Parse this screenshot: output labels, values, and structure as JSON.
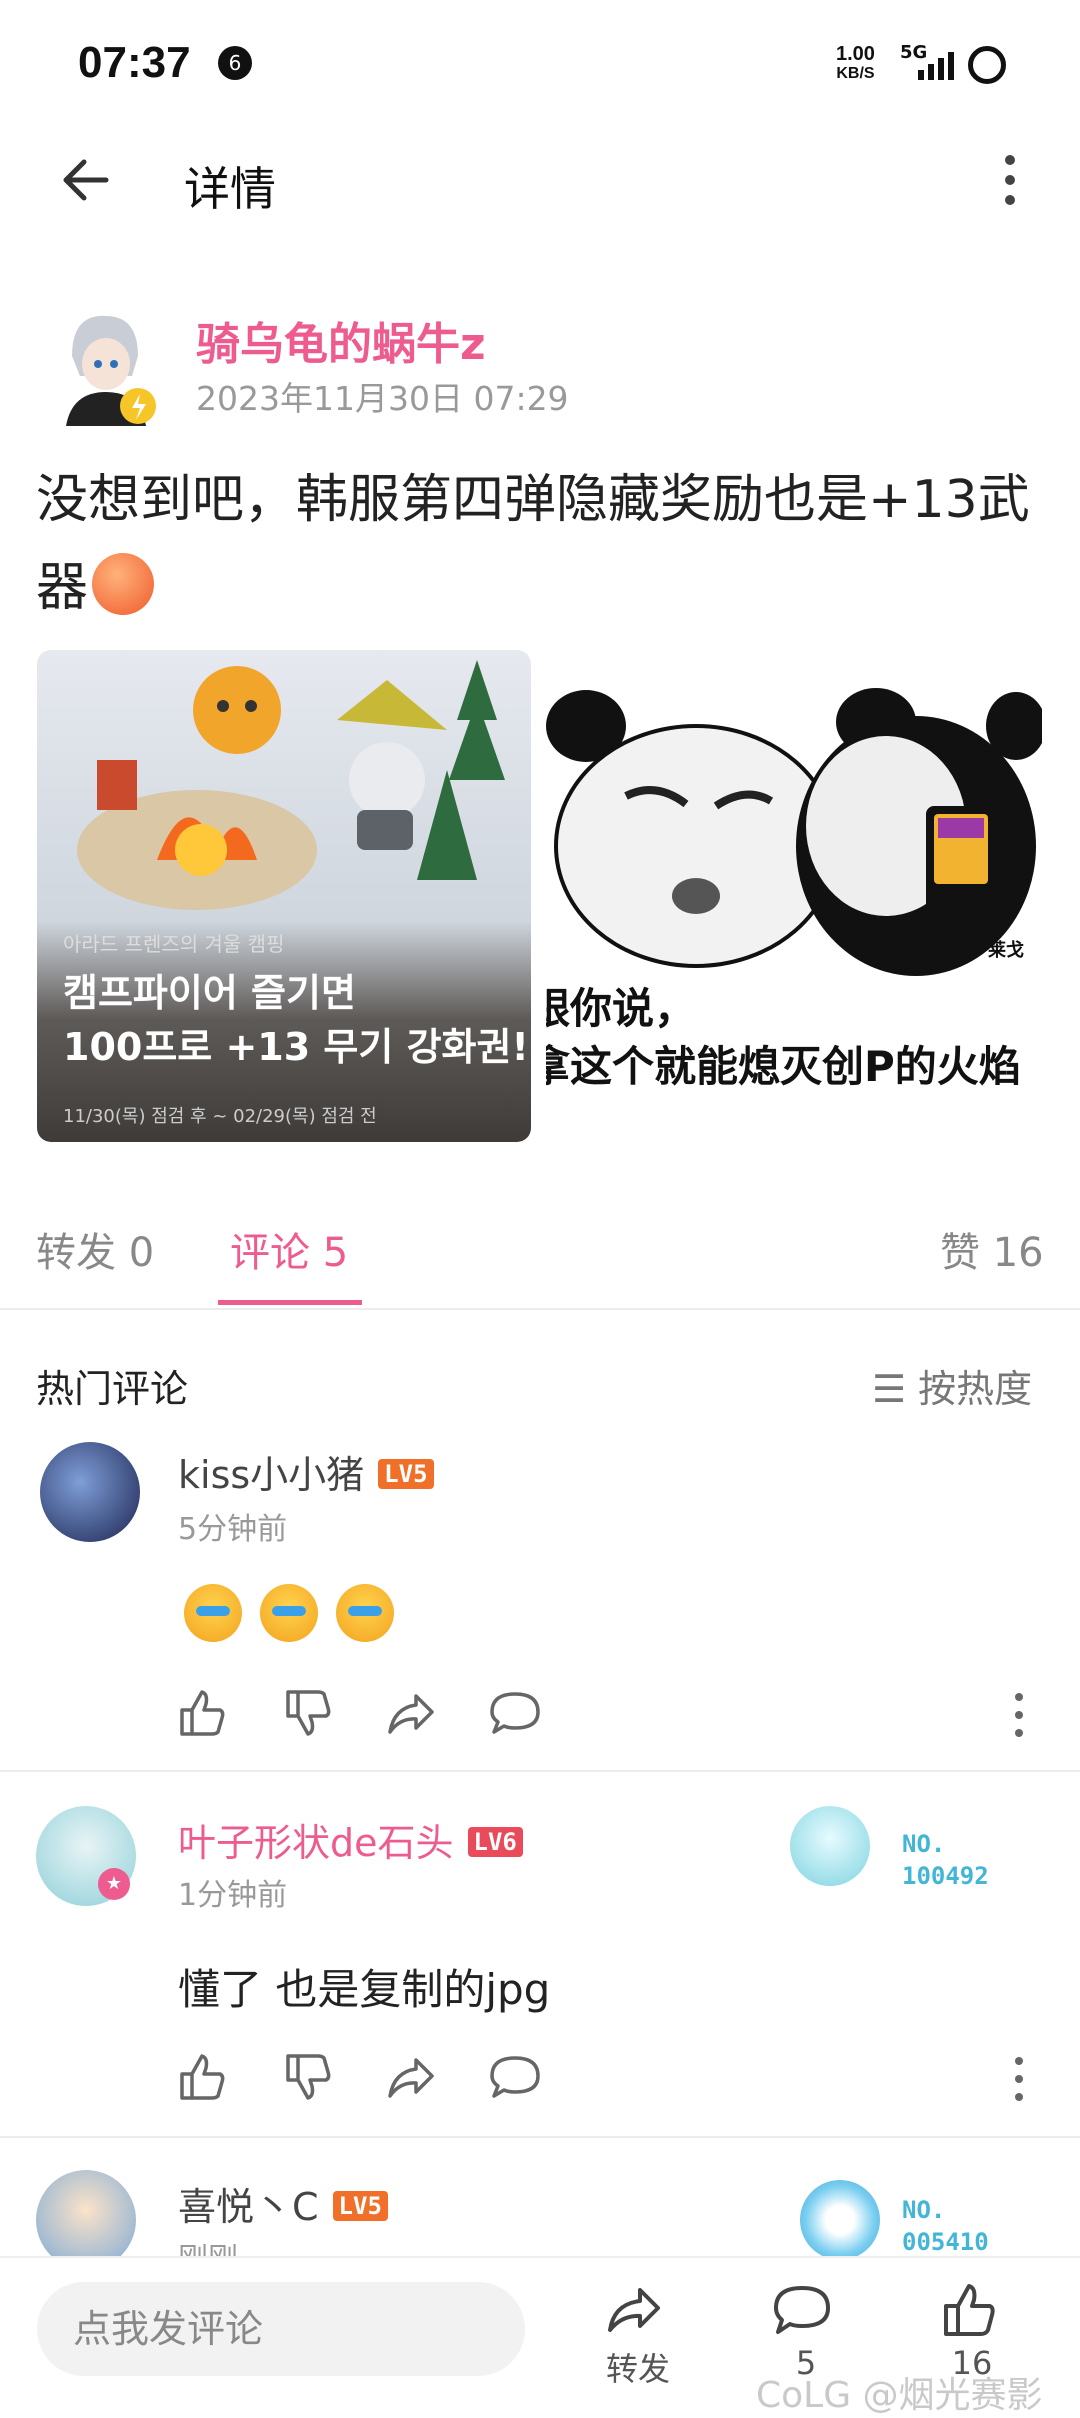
{
  "status_bar": {
    "time": "07:37",
    "notification_count": "6",
    "net_speed_value": "1.00",
    "net_speed_unit": "KB/S",
    "network_type": "5G"
  },
  "header": {
    "title": "详情"
  },
  "post": {
    "author": "骑乌龟的蜗牛z",
    "time": "2023年11月30日 07:29",
    "text": "没想到吧，韩服第四弹隐藏奖励也是+13武器",
    "image1": {
      "caption": "아라드 프렌즈의 겨울 캠핑",
      "title_line1": "캠프파이어 즐기면",
      "title_line2": "100프로 +13 무기 강화권!",
      "date": "11/30(목) 점검 후 ~ 02/29(목) 점검 전"
    },
    "image2": {
      "line1": "跟你说，",
      "line2": "拿这个就能熄灭创P的火焰",
      "corner": "莱戈"
    }
  },
  "tabs": {
    "repost": "转发 0",
    "comments": "评论 5",
    "likes": "赞 16"
  },
  "comments_section": {
    "title": "热门评论",
    "sort_label": "按热度"
  },
  "comments": [
    {
      "name": "kiss小小猪",
      "level": "LV5",
      "time": "5分钟前"
    },
    {
      "name": "叶子形状de石头",
      "level": "LV6",
      "time": "1分钟前",
      "text": "懂了  也是复制的jpg",
      "medal_no_label": "NO.",
      "medal_no": "100492"
    },
    {
      "name": "喜悦丶C",
      "level": "LV5",
      "time": "刚刚",
      "medal_no_label": "NO.",
      "medal_no": "005410"
    }
  ],
  "bottom_bar": {
    "input_placeholder": "点我发评论",
    "repost_label": "转发",
    "comment_count": "5",
    "like_count": "16",
    "watermark": "CoLG @烟光赛影"
  },
  "colors": {
    "accent_pink": "#ee5c8f",
    "level_orange": "#f0702a",
    "level_red": "#e94b5a"
  }
}
